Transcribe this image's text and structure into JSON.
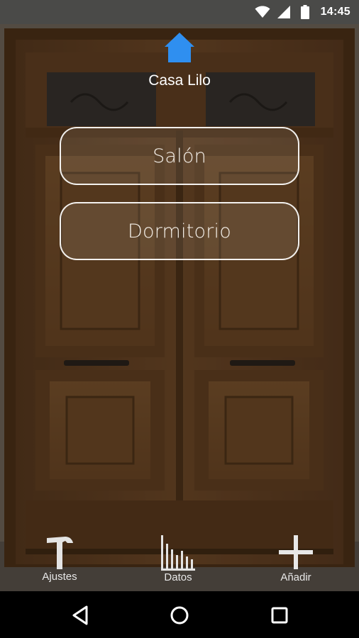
{
  "status_bar": {
    "time": "14:45",
    "icons": [
      "wifi-icon",
      "cell-signal-icon",
      "battery-icon"
    ]
  },
  "header": {
    "icon": "home-icon",
    "title": "Casa Lilo",
    "icon_color": "#2f8ff0"
  },
  "rooms": [
    {
      "label": "Salón"
    },
    {
      "label": "Dormitorio"
    }
  ],
  "toolbar": {
    "settings_label": "Ajustes",
    "settings_icon": "hammer-icon",
    "data_label": "Datos",
    "data_icon": "bar-chart-icon",
    "add_label": "Añadir",
    "add_icon": "plus-icon"
  },
  "nav_bar": {
    "icons": [
      "back-icon",
      "home-nav-icon",
      "recent-apps-icon"
    ]
  }
}
